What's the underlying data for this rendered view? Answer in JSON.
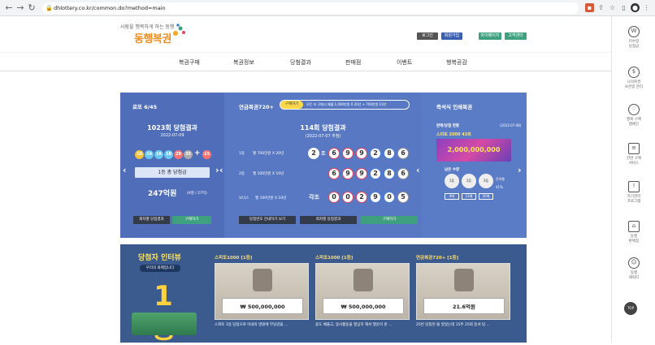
{
  "browser": {
    "url": "dhlottery.co.kr/common.do?method=main"
  },
  "header": {
    "logo_sub": "사람을 행복하게 하는 동행",
    "logo_main": "동행복권",
    "top_buttons": [
      "로그인",
      "회원가입",
      "마이페이지",
      "고객센터"
    ]
  },
  "nav": [
    "복권구매",
    "복권정보",
    "당첨결과",
    "판매점",
    "이벤트",
    "행복공감"
  ],
  "lotto": {
    "title": "로또 6/45",
    "round": "1023회 당첨결과",
    "date": "2022-07-09",
    "balls": [
      "10",
      "14",
      "16",
      "18",
      "29",
      "35"
    ],
    "plus": "+",
    "bonus": "25",
    "prize_label": "1등 총 당첨금",
    "amount": "247억원",
    "winners": "(9명 / 27억)",
    "btn_results": "회차별 당첨결과",
    "btn_buy": "구매하기"
  },
  "pension": {
    "title": "연금복권720+",
    "badge": "구매하기",
    "desc": "모든 조 구매시 매월 1,000만원 X 20년 + 700만원 10년",
    "round": "114회 당첨결과",
    "date": "(2022-07-07 추첨)",
    "rows": [
      {
        "label": "1등",
        "desc": "월 700만원 X 20년",
        "group": "2",
        "group_suffix": "조",
        "digits": [
          "6",
          "9",
          "9",
          "2",
          "8",
          "6"
        ]
      },
      {
        "label": "2등",
        "desc": "월 100만원 X 10년",
        "group": "",
        "group_suffix": "",
        "digits": [
          "6",
          "9",
          "9",
          "2",
          "8",
          "6"
        ]
      },
      {
        "label": "보너스",
        "desc": "월 100만원 X 10년",
        "group": "각조",
        "group_suffix": "",
        "digits": [
          "0",
          "0",
          "2",
          "9",
          "0",
          "5"
        ]
      }
    ],
    "btn_check": "당첨번호 안내하기 보기",
    "btn_results": "회차별 당첨결과",
    "btn_buy": "구매하기"
  },
  "instant": {
    "title": "즉석식 인쇄복권",
    "sub_title": "판매/당첨 현황",
    "date": "(2022-07-08)",
    "game": "스피또 2000 43회",
    "prize": "2,000,000,000",
    "remain_label": "남은 수량",
    "ranks": [
      "1등",
      "2등",
      "3등",
      "잔여율"
    ],
    "counts": [
      "4매",
      "13매",
      "50매",
      "41%"
    ]
  },
  "interview": {
    "title": "당첨자 인터뷰",
    "more": "우리의 화제입니다",
    "badge": "1등",
    "cards": [
      {
        "tag": "스피또1000 [1등]",
        "amount": "₩ 500,000,000",
        "caption": "스피또 1등 당첨으로 아내의 병원에 부담감을 ..."
      },
      {
        "tag": "스피또1000 [1등]",
        "amount": "₩ 500,000,000",
        "caption": "용도 베풀고, 봉사활동을 열심히 해서 행운이 온 ..."
      },
      {
        "tag": "연금복권720+ [1등]",
        "amount": "21.6억원",
        "caption": "25번 당첨된 줄 알았는데 15주 25회 등서 담 ..."
      }
    ]
  },
  "sidebar": [
    {
      "icon": "W",
      "label": "미수령\n당첨금"
    },
    {
      "icon": "$",
      "label": "나의복권\n보관함 관리"
    },
    {
      "icon": "♡",
      "label": "행복 구매\n캠페인"
    },
    {
      "icon": "≡",
      "label": "한번 구매\n서비스"
    },
    {
      "icon": "!",
      "label": "자기관리\n프로그램"
    },
    {
      "icon": "⌂",
      "label": "동행\n판매점"
    },
    {
      "icon": "☺",
      "label": "동행\n캐릭터"
    }
  ],
  "top_label": "TOP",
  "colors": {
    "brand_orange": "#f08c1e",
    "panel_blue": "#4f6db8",
    "button_green": "#3fa07f"
  }
}
